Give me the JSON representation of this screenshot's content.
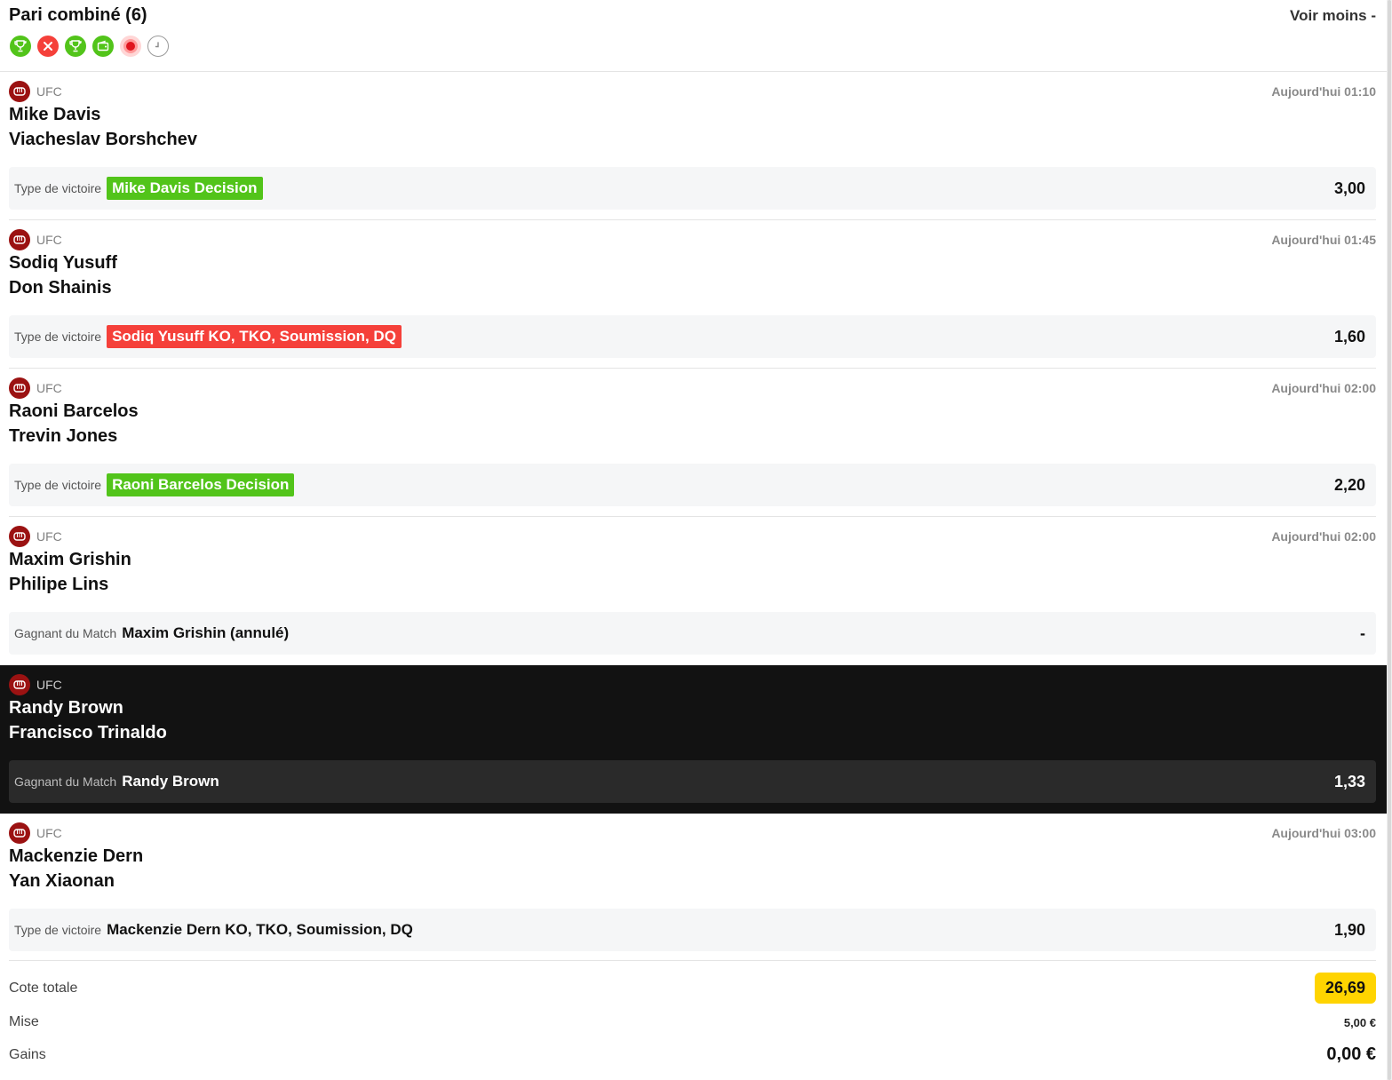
{
  "header": {
    "title": "Pari combiné (6)",
    "toggle_label": "Voir moins -",
    "status_icons": [
      {
        "name": "won-trophy-icon",
        "state": "won",
        "color": "#52c41a"
      },
      {
        "name": "lost-cross-icon",
        "state": "lost",
        "color": "#f5403a"
      },
      {
        "name": "won-trophy-icon",
        "state": "won",
        "color": "#52c41a"
      },
      {
        "name": "refunded-wallet-icon",
        "state": "refunded",
        "color": "#52c41a"
      },
      {
        "name": "live-dot-icon",
        "state": "live",
        "color": "#e0141e"
      },
      {
        "name": "pending-clock-icon",
        "state": "pending",
        "color": "#9a9a9a"
      }
    ]
  },
  "events": [
    {
      "league": "UFC",
      "time": "Aujourd'hui 01:10",
      "team1": "Mike Davis",
      "team2": "Viacheslav Borshchev",
      "market": "Type de victoire",
      "pick": "Mike Davis Decision",
      "odds": "3,00",
      "status": "won"
    },
    {
      "league": "UFC",
      "time": "Aujourd'hui 01:45",
      "team1": "Sodiq Yusuff",
      "team2": "Don Shainis",
      "market": "Type de victoire",
      "pick": "Sodiq Yusuff KO, TKO, Soumission, DQ",
      "odds": "1,60",
      "status": "lost"
    },
    {
      "league": "UFC",
      "time": "Aujourd'hui 02:00",
      "team1": "Raoni Barcelos",
      "team2": "Trevin Jones",
      "market": "Type de victoire",
      "pick": "Raoni Barcelos Decision",
      "odds": "2,20",
      "status": "won"
    },
    {
      "league": "UFC",
      "time": "Aujourd'hui 02:00",
      "team1": "Maxim Grishin",
      "team2": "Philipe Lins",
      "market": "Gagnant du Match",
      "pick": "Maxim Grishin (annulé)",
      "odds": "-",
      "status": "void"
    },
    {
      "league": "UFC",
      "time": "",
      "team1": "Randy Brown",
      "team2": "Francisco Trinaldo",
      "market": "Gagnant du Match",
      "pick": "Randy Brown",
      "odds": "1,33",
      "status": "live"
    },
    {
      "league": "UFC",
      "time": "Aujourd'hui 03:00",
      "team1": "Mackenzie Dern",
      "team2": "Yan Xiaonan",
      "market": "Type de victoire",
      "pick": "Mackenzie Dern KO, TKO, Soumission, DQ",
      "odds": "1,90",
      "status": "pending"
    }
  ],
  "totals": {
    "total_odds_label": "Cote totale",
    "total_odds_value": "26,69",
    "stake_label": "Mise",
    "stake_value": "5,00 €",
    "gains_label": "Gains",
    "gains_value": "0,00 €"
  },
  "colors": {
    "won": "#52c41a",
    "lost": "#f5403a",
    "live_background": "#121212",
    "total_badge": "#ffd400",
    "ufc_icon": "#9b1212"
  }
}
